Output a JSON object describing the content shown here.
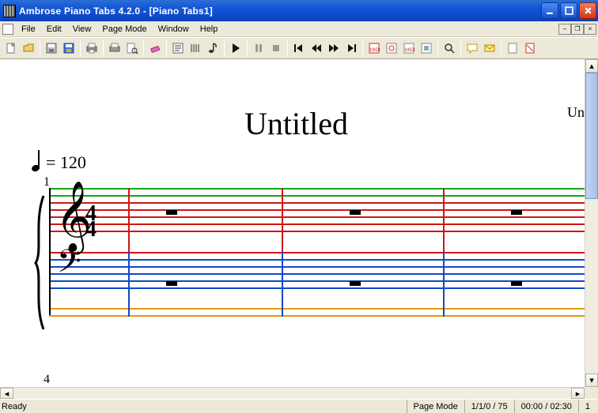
{
  "title": "Ambrose Piano Tabs 4.2.0 - [Piano Tabs1]",
  "menu": {
    "items": [
      "File",
      "Edit",
      "View",
      "Page Mode",
      "Window",
      "Help"
    ]
  },
  "toolbar_icons": [
    "new-file-icon",
    "open-file-icon",
    null,
    "save-icon",
    "save-color-icon",
    null,
    "print-all-icon",
    null,
    "print-icon",
    "print-preview-icon",
    null,
    "eraser-icon",
    null,
    "text-mode-icon",
    "tab-mode-icon",
    "music-note-icon",
    null,
    "play-icon",
    null,
    "pause-icon",
    "stop-icon",
    null,
    "skip-start-icon",
    "rewind-icon",
    "forward-icon",
    "skip-end-icon",
    null,
    "midi-map-icon",
    "midi-settings-icon",
    "midi-red-icon",
    "midi-box-icon",
    null,
    "zoom-icon",
    null,
    "chat-icon",
    "mail-icon",
    null,
    "doc1-icon",
    "doc2-icon"
  ],
  "document": {
    "title": "Untitled",
    "partial_right": "Un",
    "tempo_label": "= 120",
    "measure1": "1",
    "measure4": "4",
    "timesig_top": "4",
    "timesig_bottom": "4"
  },
  "status": {
    "ready": "Ready",
    "mode": "Page Mode",
    "position": "1/1/0  /  75",
    "time": "00:00 / 02:30",
    "extra": "1"
  }
}
